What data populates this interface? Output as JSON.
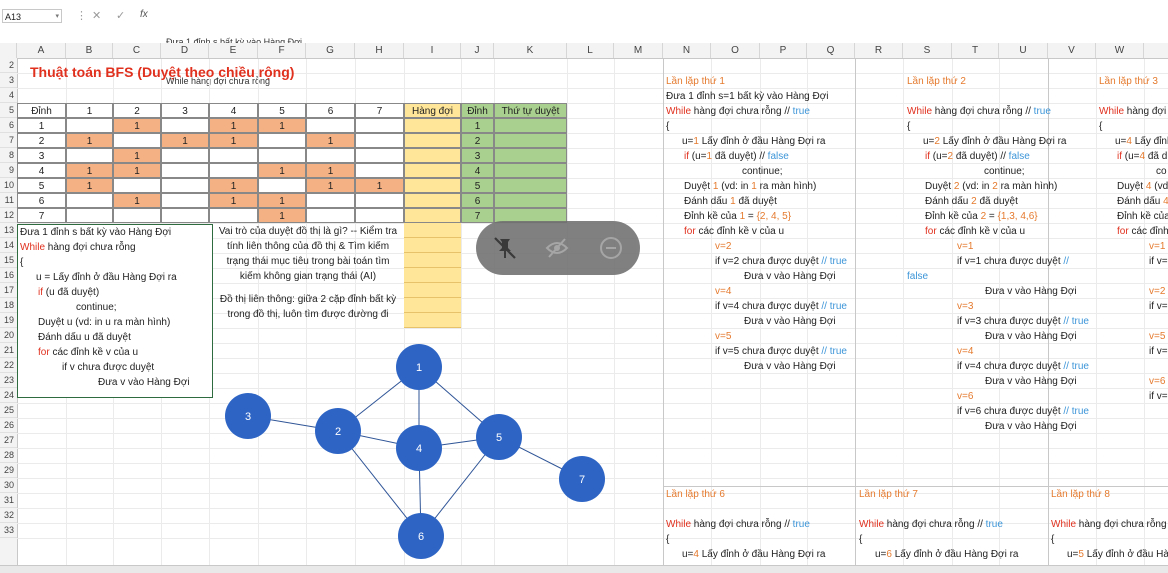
{
  "formula_bar": {
    "name_box": "A13",
    "fx_label": "fx",
    "cancel_glyph": "✕",
    "enter_glyph": "✓",
    "content_line1": "Đưa 1 đỉnh s bất kỳ vào Hàng Đợi",
    "content_line2": "While hàng đợi chưa rỗng"
  },
  "columns": [
    "A",
    "B",
    "C",
    "D",
    "E",
    "F",
    "G",
    "H",
    "I",
    "J",
    "K",
    "L",
    "M",
    "N",
    "O",
    "P",
    "Q",
    "R",
    "S",
    "T",
    "U",
    "V",
    "W"
  ],
  "rows": [
    "2",
    "3",
    "4",
    "5",
    "6",
    "7",
    "8",
    "9",
    "10",
    "11",
    "12",
    "13",
    "14",
    "15",
    "16",
    "17",
    "18",
    "19",
    "20",
    "21",
    "22",
    "23",
    "24",
    "25",
    "26",
    "27",
    "28",
    "29",
    "30",
    "31",
    "32",
    "33"
  ],
  "title": "Thuật toán BFS (Duyệt theo chiều rộng)",
  "matrix": {
    "corner": "Đỉnh",
    "headers": [
      "1",
      "2",
      "3",
      "4",
      "5",
      "6",
      "7"
    ],
    "row_labels": [
      "1",
      "2",
      "3",
      "4",
      "5",
      "6",
      "7"
    ],
    "cells": [
      [
        "",
        "1",
        "",
        "1",
        "1",
        "",
        ""
      ],
      [
        "1",
        "",
        "1",
        "1",
        "",
        "1",
        ""
      ],
      [
        "",
        "1",
        "",
        "",
        "",
        "",
        ""
      ],
      [
        "1",
        "1",
        "",
        "",
        "1",
        "1",
        ""
      ],
      [
        "1",
        "",
        "",
        "1",
        "",
        "1",
        "1"
      ],
      [
        "",
        "1",
        "",
        "1",
        "1",
        "",
        ""
      ],
      [
        "",
        "",
        "",
        "",
        "1",
        "",
        ""
      ]
    ],
    "queue_header": "Hàng đợi",
    "dinh_header": "Đỉnh",
    "order_header": "Thứ tự duyệt",
    "dinh_values": [
      "1",
      "2",
      "3",
      "4",
      "5",
      "6",
      "7"
    ]
  },
  "pseudocode": {
    "l1": "Đưa 1 đỉnh s bất kỳ vào Hàng Đợi",
    "l2a": "While",
    "l2b": " hàng đợi chưa rỗng",
    "l3": "{",
    "l4": "u = Lấy đỉnh ở đầu Hàng Đợi ra",
    "l5a": "if",
    "l5b": " (u đã duyệt)",
    "l6": "continue;",
    "l7": "Duyệt u (vd: in u ra màn hình)",
    "l8": "Đánh dấu u đã duyệt",
    "l9a": "for",
    "l9b": " các đỉnh kề v của u",
    "l10": "if v chưa được duyệt",
    "l11": "Đưa v vào Hàng Đợi"
  },
  "notes": {
    "n1": "Vai trò của duyệt đồ thị là gì? -- Kiểm tra",
    "n2": "tính liên thông của đồ thị & Tìm kiếm",
    "n3": "trạng thái mục tiêu trong bài toán tìm",
    "n4": "kiếm không gian trạng thái (AI)",
    "n5": "Đồ thị liên thông: giữa 2 cặp đỉnh bất kỳ",
    "n6": "trong đồ thị, luôn tìm được đường đi"
  },
  "graph": {
    "nodes": [
      "1",
      "2",
      "3",
      "4",
      "5",
      "6",
      "7"
    ],
    "edges": [
      [
        "1",
        "2"
      ],
      [
        "1",
        "4"
      ],
      [
        "1",
        "5"
      ],
      [
        "2",
        "3"
      ],
      [
        "2",
        "4"
      ],
      [
        "2",
        "6"
      ],
      [
        "4",
        "5"
      ],
      [
        "4",
        "6"
      ],
      [
        "5",
        "6"
      ],
      [
        "5",
        "7"
      ]
    ],
    "node_color": "#2e65c5"
  },
  "iter1": {
    "title": "Lần lặp thứ 1",
    "a1": "Đưa 1 đỉnh s=1  bất kỳ vào Hàng Đợi",
    "a2a": "While",
    "a2b": " hàng đợi chưa rỗng  //",
    "a2c": " true",
    "a3": "{",
    "a4a": "u=",
    "a4b": "1",
    "a4c": " Lấy đỉnh ở đầu Hàng Đợi ra",
    "a5a": "if",
    "a5b": " (u=",
    "a5c": "1",
    "a5d": " đã duyệt)  //",
    "a5e": " false",
    "a6": "continue;",
    "a7a": "Duyệt ",
    "a7b": "1",
    "a7c": " (vd: in ",
    "a7d": "1",
    "a7e": " ra màn hình)",
    "a8a": "Đánh dấu ",
    "a8b": "1",
    "a8c": " đã duyệt",
    "a9a": "Đỉnh kề của ",
    "a9b": "1",
    "a9c": " = ",
    "a9d": "{2, 4, 5}",
    "a10a": "for",
    "a10b": " các đỉnh kề v của u",
    "v1": "v=2",
    "c1a": "if v=2 chưa được duyệt",
    "c1b": " // true",
    "p1": "Đưa v vào Hàng Đợi",
    "v2": "v=4",
    "c2a": "if v=4 chưa được duyệt",
    "c2b": " // true",
    "p2": "Đưa v vào Hàng Đợi",
    "v3": "v=5",
    "c3a": "if v=5 chưa được duyệt",
    "c3b": " // true",
    "p3": "Đưa v vào Hàng Đợi"
  },
  "iter2": {
    "title": "Lần lặp thứ 2",
    "a2a": "While",
    "a2b": " hàng đợi chưa rỗng  //",
    "a2c": " true",
    "a3": "{",
    "a4a": "u=",
    "a4b": "2",
    "a4c": " Lấy đỉnh ở đầu Hàng Đợi ra",
    "a5a": "if",
    "a5b": " (u=",
    "a5c": "2",
    "a5d": " đã duyệt)  //",
    "a5e": " false",
    "a6": "continue;",
    "a7a": "Duyệt ",
    "a7b": "2",
    "a7c": " (vd: in ",
    "a7d": "2",
    "a7e": " ra màn hình)",
    "a8a": "Đánh dấu ",
    "a8b": "2",
    "a8c": " đã duyệt",
    "a9a": "Đỉnh kề của ",
    "a9b": "2",
    "a9c": " = ",
    "a9d": "{1,3, 4,6}",
    "a10a": "for",
    "a10b": " các đỉnh kề v của u",
    "v1": "v=1",
    "c1a": "if v=1 chưa được duyệt",
    "c1b": " //",
    "c1c": "false",
    "p1": "Đưa v vào Hàng Đợi",
    "v2": "v=3",
    "c2a": "if v=3 chưa được duyệt",
    "c2b": " // true",
    "p2": "Đưa v vào Hàng Đợi",
    "v3": "v=4",
    "c3a": "if v=4 chưa được duyệt",
    "c3b": " // true",
    "p3": "Đưa v vào Hàng Đợi",
    "v4": "v=6",
    "c4a": "if v=6 chưa được duyệt",
    "c4b": " // true",
    "p4": "Đưa v vào Hàng Đợi"
  },
  "iter3": {
    "title": "Lần lặp thứ 3",
    "a2a": "While",
    "a2b": " hàng đợi chưa rỗ",
    "a3": "{",
    "a4a": "u=",
    "a4b": "4",
    "a4c": " Lấy đỉnh ở",
    "a5a": "if",
    "a5b": " (u=",
    "a5c": "4",
    "a5d": " đã d",
    "a6": "co",
    "a7a": "Duyệt ",
    "a7b": "4",
    "a7c": " (vd",
    "a8a": "Đánh dấu ",
    "a8b": "4",
    "a9a": "Đỉnh kề của",
    "a10a": "for",
    "a10b": " các đỉnh",
    "v1": "v=1",
    "c1": "if v=",
    "v2": "v=2",
    "c2": "if v=",
    "v3": "v=5",
    "c3": "if v=",
    "v4": "v=6",
    "c4": "if v="
  },
  "iter6": {
    "title": "Lần lặp thứ 6",
    "a2a": "While",
    "a2b": " hàng đợi chưa rỗng  //",
    "a2c": " true",
    "a3": "{",
    "a4a": "u=",
    "a4b": "4",
    "a4c": " Lấy đỉnh ở đầu Hàng Đợi ra"
  },
  "iter7": {
    "title": "Lần lặp thứ 7",
    "a2a": "While",
    "a2b": " hàng đợi chưa rỗng  //",
    "a2c": " true",
    "a3": "{",
    "a4a": "u=",
    "a4b": "6",
    "a4c": " Lấy đỉnh ở đầu Hàng Đợi ra"
  },
  "iter8": {
    "title": "Lần lặp thứ 8",
    "a2a": "While",
    "a2b": " hàng đợi chưa rỗng",
    "a3": "{",
    "a4a": "u=",
    "a4b": "5",
    "a4c": " Lấy đỉnh ở đầu Hàng Đợ"
  },
  "overlay_icons": [
    "unpin-icon",
    "visibility-off-icon",
    "minus-circle-icon"
  ],
  "colors": {
    "orange_fill": "#f4b183",
    "queue_fill": "#ffe699",
    "green_fill": "#a9d08e",
    "title_red": "#e0301e",
    "keyword_blue": "#3c95d8"
  }
}
